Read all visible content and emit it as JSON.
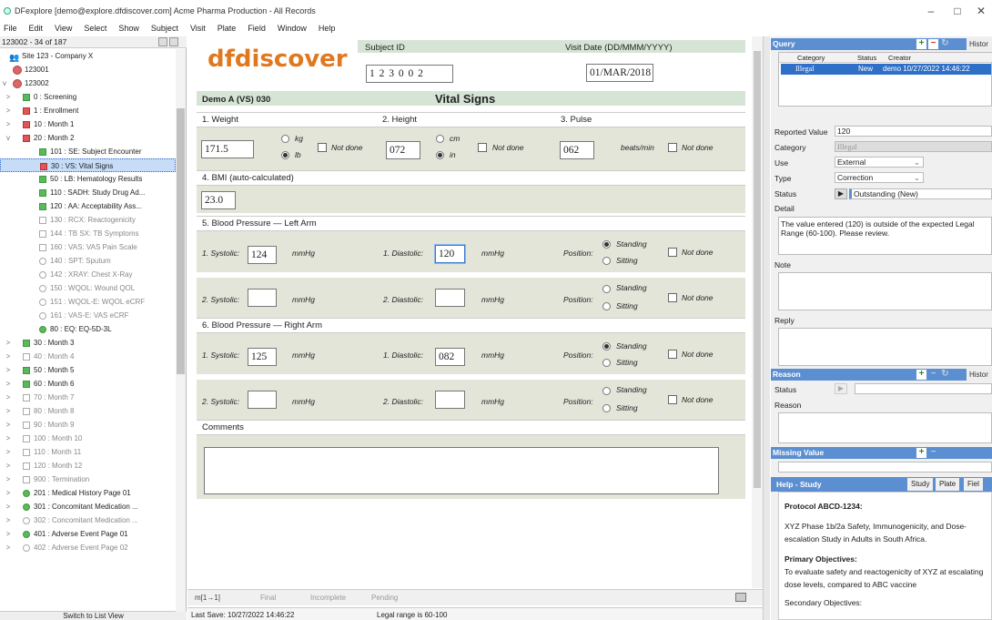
{
  "window": {
    "title": "DFexplore [demo@explore.dfdiscover.com] Acme Pharma Production - All Records",
    "minimize": "–",
    "maximize": "□",
    "close": "✕"
  },
  "menu": [
    "File",
    "Edit",
    "View",
    "Select",
    "Show",
    "Subject",
    "Visit",
    "Plate",
    "Field",
    "Window",
    "Help"
  ],
  "left": {
    "header": "123002 - 34 of 187",
    "site": "Site 123 - Company X",
    "subject1": "123001",
    "subject2": "123002",
    "items": [
      {
        "label": "0 : Screening",
        "icon": "green",
        "level": 1,
        "chev": ">"
      },
      {
        "label": "1 : Enrollment",
        "icon": "red",
        "level": 1,
        "chev": ">"
      },
      {
        "label": "10 : Month 1",
        "icon": "red",
        "level": 1,
        "chev": ">"
      },
      {
        "label": "20 : Month 2",
        "icon": "red",
        "level": 1,
        "chev": "v"
      },
      {
        "label": "101 : SE: Subject Encounter",
        "icon": "green",
        "level": 2
      },
      {
        "label": "30 : VS: Vital Signs",
        "icon": "red",
        "level": 2,
        "selected": true
      },
      {
        "label": "50 : LB: Hematology Results",
        "icon": "green",
        "level": 2
      },
      {
        "label": "110 : SADH: Study Drug Ad...",
        "icon": "green",
        "level": 2
      },
      {
        "label": "120 : AA: Acceptability Ass...",
        "icon": "green",
        "level": 2
      },
      {
        "label": "130 : RCX: Reactogenicity",
        "icon": "empty",
        "level": 2,
        "gray": true
      },
      {
        "label": "144 : TB SX: TB Symptoms",
        "icon": "empty",
        "level": 2,
        "gray": true
      },
      {
        "label": "160 : VAS: VAS Pain Scale",
        "icon": "empty",
        "level": 2,
        "gray": true
      },
      {
        "label": "140 : SPT: Sputum",
        "icon": "circle",
        "level": 2,
        "gray": true
      },
      {
        "label": "142 : XRAY: Chest X-Ray",
        "icon": "circle",
        "level": 2,
        "gray": true
      },
      {
        "label": "150 : WQOL: Wound QOL",
        "icon": "circle",
        "level": 2,
        "gray": true
      },
      {
        "label": "151 : WQOL-E: WQOL eCRF",
        "icon": "circle",
        "level": 2,
        "gray": true
      },
      {
        "label": "161 : VAS-E: VAS eCRF",
        "icon": "circle",
        "level": 2,
        "gray": true
      },
      {
        "label": "80 : EQ: EQ-5D-3L",
        "icon": "gcircle",
        "level": 2
      },
      {
        "label": "30 : Month 3",
        "icon": "green",
        "level": 1,
        "chev": ">"
      },
      {
        "label": "40 : Month 4",
        "icon": "empty",
        "level": 1,
        "chev": ">",
        "gray": true
      },
      {
        "label": "50 : Month 5",
        "icon": "green",
        "level": 1,
        "chev": ">"
      },
      {
        "label": "60 : Month 6",
        "icon": "green",
        "level": 1,
        "chev": ">"
      },
      {
        "label": "70 : Month 7",
        "icon": "empty",
        "level": 1,
        "chev": ">",
        "gray": true
      },
      {
        "label": "80 : Month 8",
        "icon": "empty",
        "level": 1,
        "chev": ">",
        "gray": true
      },
      {
        "label": "90 : Month 9",
        "icon": "empty",
        "level": 1,
        "chev": ">",
        "gray": true
      },
      {
        "label": "100 : Month 10",
        "icon": "empty",
        "level": 1,
        "chev": ">",
        "gray": true
      },
      {
        "label": "110 : Month 11",
        "icon": "empty",
        "level": 1,
        "chev": ">",
        "gray": true
      },
      {
        "label": "120 : Month 12",
        "icon": "empty",
        "level": 1,
        "chev": ">",
        "gray": true
      },
      {
        "label": "900 : Termination",
        "icon": "empty",
        "level": 1,
        "chev": ">",
        "gray": true
      },
      {
        "label": "201 : Medical History Page 01",
        "icon": "gcircle",
        "level": 1,
        "chev": ">"
      },
      {
        "label": "301 : Concomitant Medication ...",
        "icon": "gcircle",
        "level": 1,
        "chev": ">"
      },
      {
        "label": "302 : Concomitant Medication ...",
        "icon": "circle",
        "level": 1,
        "chev": ">",
        "gray": true
      },
      {
        "label": "401 : Adverse Event Page 01",
        "icon": "gcircle",
        "level": 1,
        "chev": ">"
      },
      {
        "label": "402 : Adverse Event Page 02",
        "icon": "circle",
        "level": 1,
        "chev": ">",
        "gray": true
      }
    ],
    "footer": "Switch to List View"
  },
  "form": {
    "logo": "dfdiscover",
    "subject_id_label": "Subject ID",
    "subject_id": "1 2 3 0 0 2",
    "visit_date_label": "Visit Date (DD/MMM/YYYY)",
    "visit_date": "01/MAR/2018",
    "plate": "Demo A (VS) 030",
    "title": "Vital Signs",
    "weight_label": "1. Weight",
    "height_label": "2. Height",
    "pulse_label": "3. Pulse",
    "weight": "171.5",
    "kg": "kg",
    "lb": "lb",
    "not_done": "Not done",
    "height": "072",
    "cm": "cm",
    "in": "in",
    "pulse": "062",
    "beats": "beats/min",
    "bmi_label": "4. BMI (auto-calculated)",
    "bmi": "23.0",
    "bp_left_label": "5. Blood Pressure — Left Arm",
    "bp_right_label": "6. Blood Pressure — Right Arm",
    "sys1": "1. Systolic:",
    "sys2": "2. Systolic:",
    "dia1": "1. Diastolic:",
    "dia2": "2. Diastolic:",
    "mmhg": "mmHg",
    "position": "Position:",
    "standing": "Standing",
    "sitting": "Sitting",
    "left_sys1": "124",
    "left_dia1": "120",
    "right_sys1": "125",
    "right_dia1": "082",
    "comments_label": "Comments"
  },
  "status": {
    "mark": "m[1→1]",
    "final": "Final",
    "incomplete": "Incomplete",
    "pending": "Pending",
    "last_save": "Last Save: 10/27/2022 14:46:22",
    "legal_range": "Legal range is 60-100"
  },
  "query": {
    "header": "Query",
    "history": "Histor",
    "col_category": "Category",
    "col_status": "Status",
    "col_creator": "Creator",
    "row_category": "Illegal",
    "row_status": "New",
    "row_creator": "demo 10/27/2022 14:46:22",
    "reported_value_label": "Reported Value",
    "reported_value": "120",
    "category_label": "Category",
    "category_value": "Illegal",
    "use_label": "Use",
    "use_value": "External",
    "type_label": "Type",
    "type_value": "Correction",
    "status_label": "Status",
    "status_value": "Outstanding (New)",
    "detail_label": "Detail",
    "detail_text": "The value entered (120) is outside of the expected Legal Range (60-100). Please review.",
    "note_label": "Note",
    "reply_label": "Reply"
  },
  "reason": {
    "header": "Reason",
    "history": "Histor",
    "status_label": "Status",
    "reason_label": "Reason"
  },
  "missing": {
    "header": "Missing Value"
  },
  "help": {
    "header": "Help - Study",
    "tab_study": "Study",
    "tab_plate": "Plate",
    "tab_field": "Fiel",
    "protocol": "Protocol ABCD-1234:",
    "desc": "XYZ Phase 1b/2a Safety, Immunogenicity, and Dose-escalation Study in Adults in South Africa.",
    "primary": "Primary Objectives:",
    "primary_text": "To evaluate safety and reactogenicity of XYZ at escalating dose levels, compared to ABC vaccine",
    "secondary": "Secondary Objectives:"
  },
  "colors": {
    "accent": "#5b8fd1",
    "field_bg": "#e2e5d8",
    "header_bg": "#d6e4d6",
    "logo": "#e07820"
  }
}
